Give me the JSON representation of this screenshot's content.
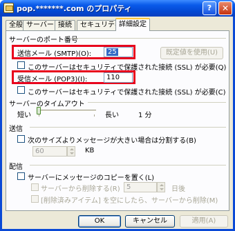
{
  "window": {
    "title": "pop.*******.com のプロパティ",
    "help_label": "?",
    "close_label": "✕"
  },
  "tabs": [
    {
      "label": "全般"
    },
    {
      "label": "サーバー"
    },
    {
      "label": "接続"
    },
    {
      "label": "セキュリティ"
    },
    {
      "label": "詳細設定"
    }
  ],
  "server_ports": {
    "heading": "サーバーのポート番号",
    "smtp_label": "送信メール (SMTP)(O):",
    "smtp_value": "25",
    "defaults_button": "既定値を使用(U)",
    "smtp_ssl_label": "このサーバーはセキュリティで保護された接続 (SSL) が必要(Q)",
    "pop3_label": "受信メール (POP3)(I):",
    "pop3_value": "110",
    "pop3_ssl_label": "このサーバーはセキュリティで保護された接続 (SSL) が必要(C)"
  },
  "timeout": {
    "heading": "サーバーのタイムアウト",
    "short_label": "短い",
    "long_label": "長い",
    "value_text": "1 分",
    "level_fraction": 0.0
  },
  "sending": {
    "heading": "送信",
    "split_label": "次のサイズよりメッセージが大きい場合は分割する(B)",
    "split_value": "60",
    "split_unit": "KB"
  },
  "delivery": {
    "heading": "配信",
    "keep_copy_label": "サーバーにメッセージのコピーを置く(L)",
    "remove_after_label": "サーバーから削除する(R)",
    "remove_after_value": "5",
    "days_unit": "日後",
    "remove_deleted_label": "[削除済みアイテム] を空にしたら、サーバーから削除(M)"
  },
  "buttons": {
    "ok": "OK",
    "cancel": "キャンセル",
    "apply": "適用(A)"
  },
  "colors": {
    "highlight_box": "#e8001c",
    "titlebar": "#0a5bea",
    "dialog_bg": "#ece9d8"
  }
}
